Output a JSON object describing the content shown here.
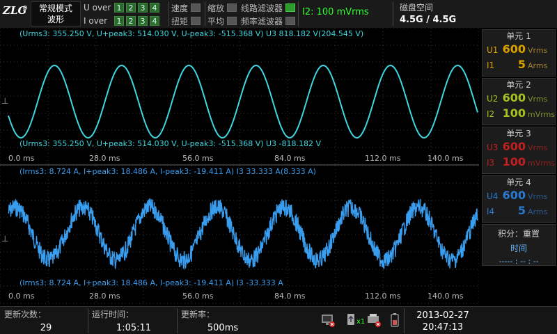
{
  "header": {
    "logo": "ZLG",
    "mode": [
      "常规模式",
      "波形"
    ],
    "u_over_label": "U over",
    "i_over_label": "I over",
    "levels": [
      "1",
      "2",
      "3",
      "4"
    ],
    "flags": {
      "speed": "速度",
      "torque": "扭矩",
      "zoom": "缩放",
      "average": "平均",
      "line_filter": "线路滤波器",
      "freq_filter": "频率滤波器"
    },
    "i_range": "I2: 100 mVrms",
    "disk_label": "磁盘空间",
    "disk_value": "4.5G / 4.5G"
  },
  "wave1": {
    "top_label": "(Urms3: 355.250 V, U+peak3: 514.030 V, U-peak3: -515.368 V) U3    818.182 V(204.545 V)",
    "bottom_label": "(Urms3: 355.250 V, U+peak3: 514.030 V, U-peak3: -515.368 V) U3    -818.182 V",
    "color": "#3fd8e0"
  },
  "wave2": {
    "top_label": "(Irms3: 8.724 A, I+peak3: 18.486 A, I-peak3: -19.411 A) I3    33.333 A(8.333 A)",
    "bottom_label": "(Irms3: 8.724 A, I+peak3: 18.486 A, I-peak3: -19.411 A) I3    -33.333 A",
    "color": "#3a9ef0"
  },
  "time_ticks": [
    "0.0 ms",
    "28.0 ms",
    "56.0 ms",
    "84.0 ms",
    "112.0 ms",
    "140.0 ms"
  ],
  "ground_marker": "⊥",
  "units": [
    {
      "title": "单元 1",
      "u_name": "U1",
      "u_val": "600",
      "u_unit": "Vrms",
      "i_name": "I1",
      "i_val": "5",
      "i_unit": "Arms",
      "color": "#d9a100",
      "unit_color": "#a08030"
    },
    {
      "title": "单元 2",
      "u_name": "U2",
      "u_val": "600",
      "u_unit": "Vrms",
      "i_name": "I2",
      "i_val": "100",
      "i_unit": "mVrms",
      "color": "#a8c020",
      "unit_color": "#809030"
    },
    {
      "title": "单元 3",
      "u_name": "U3",
      "u_val": "600",
      "u_unit": "Vrms",
      "i_name": "I3",
      "i_val": "100",
      "i_unit": "mVrms",
      "color": "#c02020",
      "unit_color": "#902020"
    },
    {
      "title": "单元 4",
      "u_name": "U4",
      "u_val": "600",
      "u_unit": "Vrms",
      "i_name": "I4",
      "i_val": "5",
      "i_unit": "Arms",
      "color": "#2a7ad0",
      "unit_color": "#2a5a90"
    }
  ],
  "integration": {
    "title": "积分：重置",
    "label": "时间",
    "value": "----- : -- : --"
  },
  "footer": {
    "update_count_label": "更新次数：",
    "update_count": "29",
    "run_time_label": "运行时间：",
    "run_time": "1:05:11",
    "update_rate_label": "更新率：",
    "update_rate": "500ms",
    "usb_count": "x1",
    "date": "2013-02-27",
    "time": "20:47:13"
  }
}
